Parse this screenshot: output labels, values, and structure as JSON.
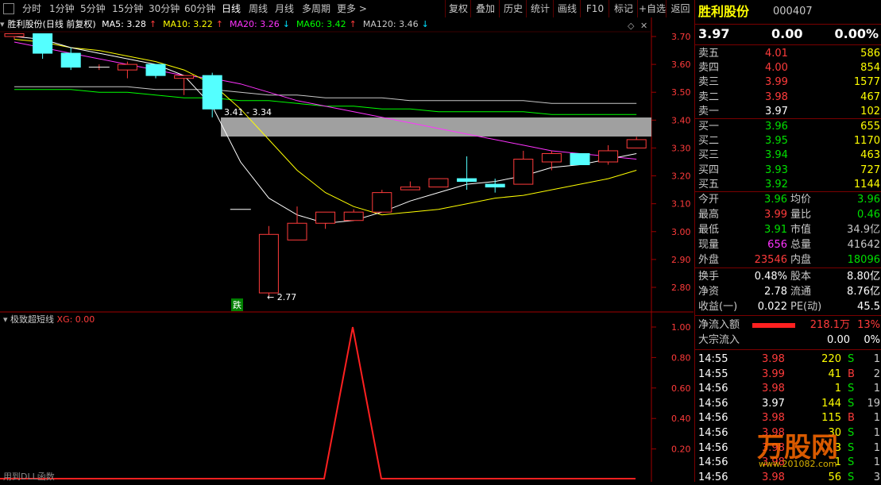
{
  "period_tabs": [
    "分时",
    "1分钟",
    "5分钟",
    "15分钟",
    "30分钟",
    "60分钟",
    "日线",
    "周线",
    "月线",
    "多周期",
    "更多 >"
  ],
  "active_period": "日线",
  "tool_buttons": [
    "复权",
    "叠加",
    "历史",
    "统计",
    "画线",
    "F10",
    "标记",
    "+自选",
    "返回"
  ],
  "stock": {
    "name": "胜利股份",
    "code": "000407"
  },
  "chart_title": "胜利股份(日线 前复权)",
  "ma": [
    {
      "label": "MA5: 3.28",
      "arrow": "↑",
      "color": "#ffffff"
    },
    {
      "label": "MA10: 3.22",
      "arrow": "↑",
      "color": "#ffff00"
    },
    {
      "label": "MA20: 3.26",
      "arrow": "↓",
      "color": "#ff33ff"
    },
    {
      "label": "MA60: 3.42",
      "arrow": "↑",
      "color": "#00ff00"
    },
    {
      "label": "MA120: 3.46",
      "arrow": "↓",
      "color": "#c8c8c8"
    }
  ],
  "annotations": {
    "range_label": "3.41 - 3.34",
    "low_label": "← 2.77",
    "drop_tag": "跌"
  },
  "price_axis": [
    "3.70",
    "3.60",
    "3.50",
    "3.40",
    "3.30",
    "3.20",
    "3.10",
    "3.00",
    "2.90",
    "2.80"
  ],
  "indicator": {
    "name": "极致超短线",
    "xg_label": "XG: 0.00",
    "footer": "用到DLL函数",
    "axis": [
      "1.00",
      "0.80",
      "0.60",
      "0.40",
      "0.20"
    ]
  },
  "quote": {
    "price": "3.97",
    "change": "0.00",
    "pct": "0.00%"
  },
  "sell": [
    {
      "label": "卖五",
      "price": "4.01",
      "vol": "586"
    },
    {
      "label": "卖四",
      "price": "4.00",
      "vol": "854"
    },
    {
      "label": "卖三",
      "price": "3.99",
      "vol": "1577"
    },
    {
      "label": "卖二",
      "price": "3.98",
      "vol": "467"
    },
    {
      "label": "卖一",
      "price": "3.97",
      "vol": "102"
    }
  ],
  "buy": [
    {
      "label": "买一",
      "price": "3.96",
      "vol": "655"
    },
    {
      "label": "买二",
      "price": "3.95",
      "vol": "1170"
    },
    {
      "label": "买三",
      "price": "3.94",
      "vol": "463"
    },
    {
      "label": "买四",
      "price": "3.93",
      "vol": "727"
    },
    {
      "label": "买五",
      "price": "3.92",
      "vol": "1144"
    }
  ],
  "stats": [
    {
      "l1": "今开",
      "v1": "3.96",
      "c1": "green",
      "l2": "均价",
      "v2": "3.96",
      "c2": "green"
    },
    {
      "l1": "最高",
      "v1": "3.99",
      "c1": "red",
      "l2": "量比",
      "v2": "0.46",
      "c2": "green"
    },
    {
      "l1": "最低",
      "v1": "3.91",
      "c1": "green",
      "l2": "市值",
      "v2": "34.9亿",
      "c2": "gray"
    },
    {
      "l1": "现量",
      "v1": "656",
      "c1": "magenta",
      "l2": "总量",
      "v2": "41642",
      "c2": "gray"
    },
    {
      "l1": "外盘",
      "v1": "23546",
      "c1": "red",
      "l2": "内盘",
      "v2": "18096",
      "c2": "green"
    }
  ],
  "stats2": [
    {
      "l1": "换手",
      "v1": "0.48%",
      "l2": "股本",
      "v2": "8.80亿"
    },
    {
      "l1": "净资",
      "v1": "2.78",
      "l2": "流通",
      "v2": "8.76亿"
    },
    {
      "l1": "收益(一)",
      "v1": "0.022",
      "l2": "PE(动)",
      "v2": "45.5"
    }
  ],
  "flow": [
    {
      "label": "净流入额",
      "value": "218.1万",
      "pct": "13%"
    },
    {
      "label": "大宗流入",
      "value": "0.00",
      "pct": "0%"
    }
  ],
  "ticks": [
    {
      "time": "14:55",
      "price": "3.98",
      "vol": "220",
      "bs": "S",
      "n": "1"
    },
    {
      "time": "14:55",
      "price": "3.99",
      "vol": "41",
      "bs": "B",
      "n": "2"
    },
    {
      "time": "14:56",
      "price": "3.98",
      "vol": "1",
      "bs": "S",
      "n": "1"
    },
    {
      "time": "14:56",
      "price": "3.97",
      "vol": "144",
      "bs": "S",
      "n": "19"
    },
    {
      "time": "14:56",
      "price": "3.98",
      "vol": "115",
      "bs": "B",
      "n": "1"
    },
    {
      "time": "14:56",
      "price": "3.98",
      "vol": "30",
      "bs": "S",
      "n": "1"
    },
    {
      "time": "14:56",
      "price": "3.98",
      "vol": "3",
      "bs": "S",
      "n": "1"
    },
    {
      "time": "14:56",
      "price": "3.98",
      "vol": "1",
      "bs": "S",
      "n": "1"
    },
    {
      "time": "14:56",
      "price": "3.98",
      "vol": "56",
      "bs": "S",
      "n": "3"
    }
  ],
  "watermark": {
    "text": "万股网",
    "sub": "www.201082.com"
  },
  "candles": [
    {
      "o": 3.7,
      "h": 3.71,
      "l": 3.69,
      "c": 3.71
    },
    {
      "o": 3.71,
      "h": 3.71,
      "l": 3.62,
      "c": 3.64
    },
    {
      "o": 3.64,
      "h": 3.66,
      "l": 3.58,
      "c": 3.59
    },
    {
      "o": 3.59,
      "h": 3.6,
      "l": 3.58,
      "c": 3.59
    },
    {
      "o": 3.58,
      "h": 3.61,
      "l": 3.55,
      "c": 3.6
    },
    {
      "o": 3.6,
      "h": 3.6,
      "l": 3.55,
      "c": 3.56
    },
    {
      "o": 3.55,
      "h": 3.56,
      "l": 3.49,
      "c": 3.56
    },
    {
      "o": 3.56,
      "h": 3.57,
      "l": 3.41,
      "c": 3.44
    },
    {
      "o": 3.08,
      "h": 3.08,
      "l": 3.08,
      "c": 3.08
    },
    {
      "o": 2.78,
      "h": 3.02,
      "l": 2.77,
      "c": 2.99
    },
    {
      "o": 2.97,
      "h": 3.09,
      "l": 2.97,
      "c": 3.03
    },
    {
      "o": 3.03,
      "h": 3.07,
      "l": 3.01,
      "c": 3.07
    },
    {
      "o": 3.04,
      "h": 3.08,
      "l": 3.04,
      "c": 3.07
    },
    {
      "o": 3.07,
      "h": 3.15,
      "l": 3.07,
      "c": 3.14
    },
    {
      "o": 3.15,
      "h": 3.18,
      "l": 3.15,
      "c": 3.16
    },
    {
      "o": 3.16,
      "h": 3.19,
      "l": 3.16,
      "c": 3.19
    },
    {
      "o": 3.19,
      "h": 3.27,
      "l": 3.15,
      "c": 3.18
    },
    {
      "o": 3.17,
      "h": 3.19,
      "l": 3.14,
      "c": 3.16
    },
    {
      "o": 3.17,
      "h": 3.29,
      "l": 3.17,
      "c": 3.26
    },
    {
      "o": 3.25,
      "h": 3.29,
      "l": 3.22,
      "c": 3.28
    },
    {
      "o": 3.28,
      "h": 3.28,
      "l": 3.24,
      "c": 3.24
    },
    {
      "o": 3.25,
      "h": 3.31,
      "l": 3.24,
      "c": 3.29
    },
    {
      "o": 3.3,
      "h": 3.34,
      "l": 3.3,
      "c": 3.33
    }
  ]
}
